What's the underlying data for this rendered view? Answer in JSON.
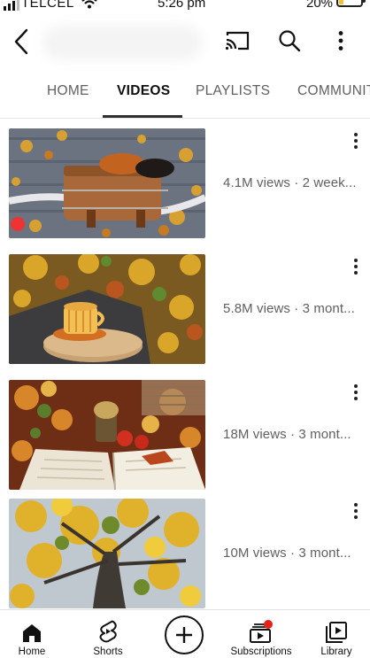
{
  "status_bar": {
    "carrier": "TELCEL",
    "time": "5:26 pm",
    "battery": "20%",
    "battery_level": 0.2
  },
  "header": {
    "icons": [
      "back-arrow-icon",
      "cast-icon",
      "search-icon",
      "more-vert-icon"
    ]
  },
  "tabs": [
    {
      "label": "HOME",
      "active": false
    },
    {
      "label": "VIDEOS",
      "active": true
    },
    {
      "label": "PLAYLISTS",
      "active": false
    },
    {
      "label": "COMMUNITY",
      "active": false
    }
  ],
  "videos": [
    {
      "meta": "4.1M views · 2 week...",
      "thumbnail": "bicycle-basket-autumn-leaves"
    },
    {
      "meta": "5.8M views · 3 mont...",
      "thumbnail": "tea-cup-autumn-leaves"
    },
    {
      "meta": "18M views · 3 mont...",
      "thumbnail": "open-book-lantern-autumn"
    },
    {
      "meta": "10M views · 3 mont...",
      "thumbnail": "yellow-autumn-tree"
    }
  ],
  "bottom_nav": [
    {
      "label": "Home",
      "icon": "home-icon"
    },
    {
      "label": "Shorts",
      "icon": "shorts-icon"
    },
    {
      "label": "",
      "icon": "create-plus-icon"
    },
    {
      "label": "Subscriptions",
      "icon": "subscriptions-icon"
    },
    {
      "label": "Library",
      "icon": "library-icon"
    }
  ],
  "colors": {
    "notification_dot": "#e62117",
    "active_tab_underline": "#303030",
    "battery": "#f2c230"
  }
}
